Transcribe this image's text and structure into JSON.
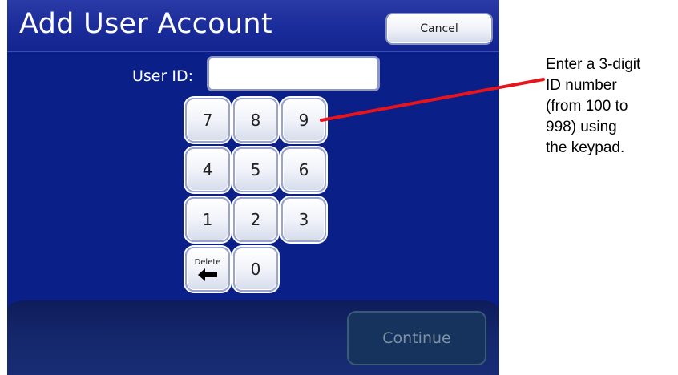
{
  "screen": {
    "title": "Add User Account",
    "cancel_label": "Cancel",
    "user_id_label": "User ID:",
    "user_id_value": "",
    "keypad": {
      "row1": [
        "7",
        "8",
        "9"
      ],
      "row2": [
        "4",
        "5",
        "6"
      ],
      "row3": [
        "1",
        "2",
        "3"
      ],
      "delete_label": "Delete",
      "delete_icon": "left-arrow-icon",
      "zero": "0"
    },
    "continue_label": "Continue",
    "continue_enabled": false
  },
  "annotation": {
    "lines": [
      "Enter a 3-digit",
      "ID number",
      "(from 100 to",
      "998) using",
      "the keypad."
    ],
    "line_color": "#e8141c"
  },
  "colors": {
    "screen_background": "#0a1f88",
    "title_bar": "#1a2c9a",
    "bottom_panel": "#14276b",
    "continue_disabled_text": "#7e93a6"
  }
}
